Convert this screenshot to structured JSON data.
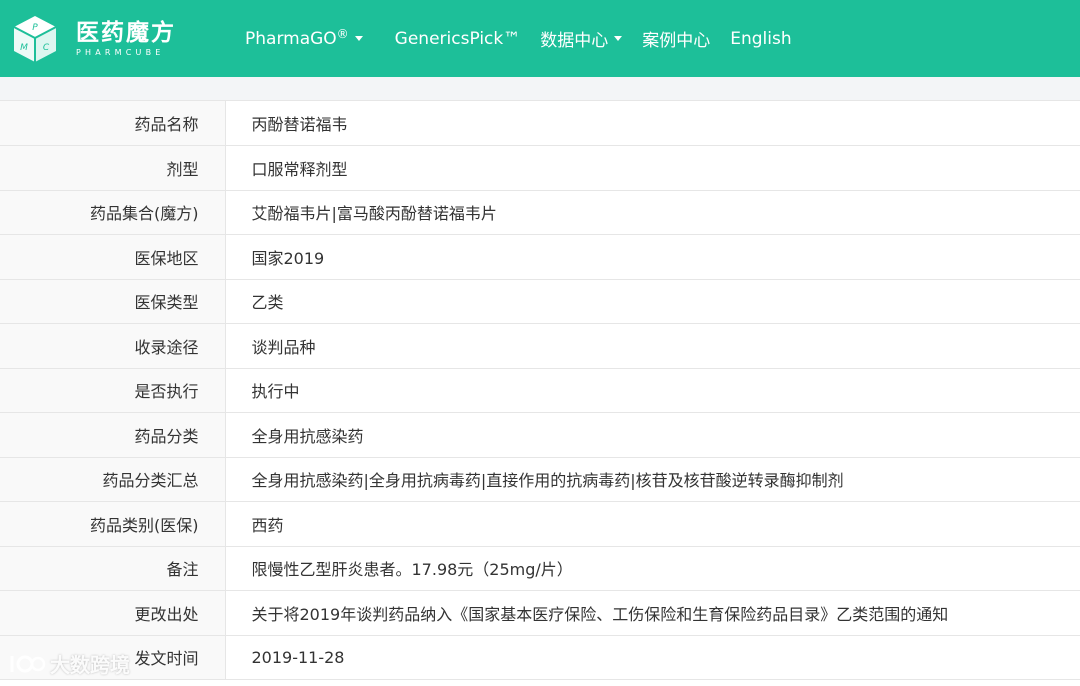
{
  "brand": {
    "name_cn": "医药魔方",
    "name_en": "PHARMCUBE",
    "cube_letters": [
      "P",
      "M",
      "C"
    ]
  },
  "nav": {
    "pharmago": "PharmaGO",
    "pharmago_mark": "®",
    "generics": "GenericsPick™",
    "data_center": "数据中心",
    "case_center": "案例中心",
    "english": "English"
  },
  "colors": {
    "nav_bg": "#1dbf99",
    "label_bg": "#f9f9f9",
    "border": "#e6e6e6"
  },
  "rows": [
    {
      "label": "药品名称",
      "value": "丙酚替诺福韦"
    },
    {
      "label": "剂型",
      "value": "口服常释剂型"
    },
    {
      "label": "药品集合(魔方)",
      "value": "艾酚福韦片|富马酸丙酚替诺福韦片"
    },
    {
      "label": "医保地区",
      "value": "国家2019"
    },
    {
      "label": "医保类型",
      "value": "乙类"
    },
    {
      "label": "收录途径",
      "value": "谈判品种"
    },
    {
      "label": "是否执行",
      "value": "执行中"
    },
    {
      "label": "药品分类",
      "value": "全身用抗感染药"
    },
    {
      "label": "药品分类汇总",
      "value": "全身用抗感染药|全身用抗病毒药|直接作用的抗病毒药|核苷及核苷酸逆转录酶抑制剂"
    },
    {
      "label": "药品类别(医保)",
      "value": "西药"
    },
    {
      "label": "备注",
      "value": "限慢性乙型肝炎患者。17.98元（25mg/片）"
    },
    {
      "label": "更改出处",
      "value": "关于将2019年谈判药品纳入《国家基本医疗保险、工伤保险和生育保险药品目录》乙类范围的通知"
    },
    {
      "label": "发文时间",
      "value": "2019-11-28"
    }
  ],
  "watermark": "大数跨境"
}
